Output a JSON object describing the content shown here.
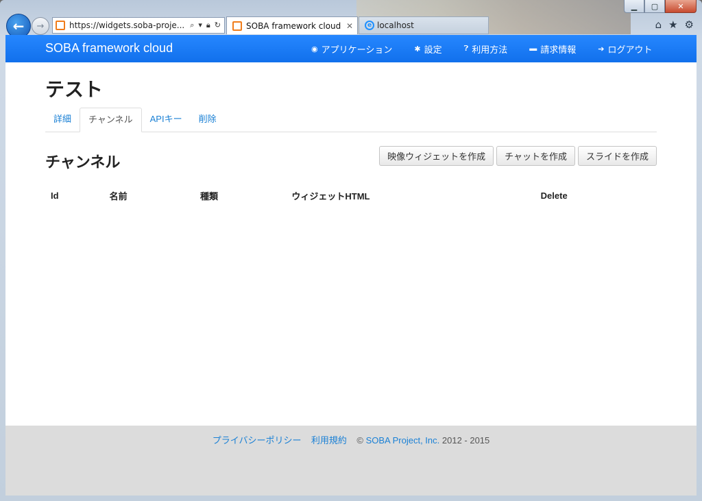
{
  "browser": {
    "url": "https://widgets.soba-proje...",
    "active_tab": "SOBA framework cloud",
    "inactive_tab": "localhost",
    "window_controls": [
      "minimize-icon",
      "maximize-icon",
      "close-icon"
    ],
    "toolbar_icons": [
      "home-icon",
      "star-icon",
      "gear-icon"
    ]
  },
  "navbar": {
    "brand": "SOBA framework cloud",
    "links": [
      {
        "icon": "globe-icon",
        "label": "アプリケーション"
      },
      {
        "icon": "cog-icon",
        "label": "設定"
      },
      {
        "icon": "question-icon",
        "label": "利用方法"
      },
      {
        "icon": "credit-card-icon",
        "label": "請求情報"
      },
      {
        "icon": "arrow-right-icon",
        "label": "ログアウト"
      }
    ]
  },
  "page": {
    "title": "テスト",
    "tabs": [
      "詳細",
      "チャンネル",
      "APIキー",
      "削除"
    ],
    "active_tab": "チャンネル",
    "section_title": "チャンネル",
    "buttons": [
      "映像ウィジェットを作成",
      "チャットを作成",
      "スライドを作成"
    ],
    "table_headers": [
      "Id",
      "名前",
      "種類",
      "ウィジェットHTML",
      "Delete"
    ]
  },
  "footer": {
    "privacy": "プライバシーポリシー",
    "terms": "利用規約",
    "copyright_prefix": "©",
    "company": "SOBA Project, Inc.",
    "years": "2012 - 2015"
  }
}
